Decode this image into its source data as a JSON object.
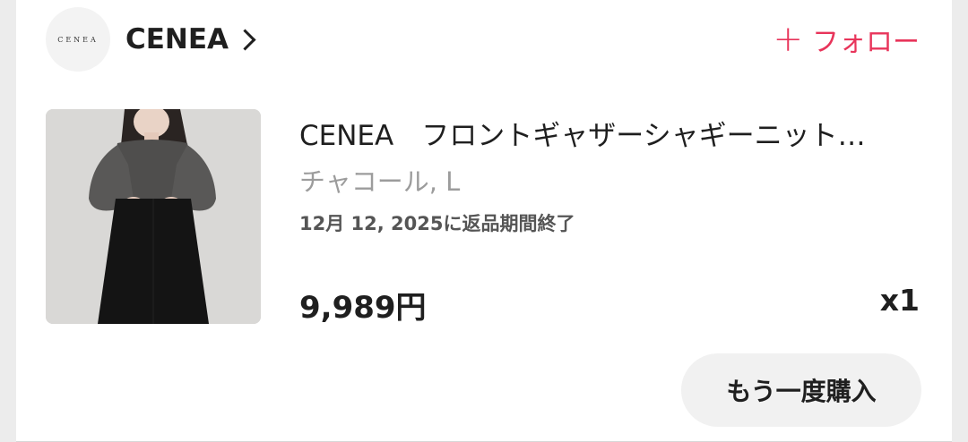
{
  "shop": {
    "logo_text": "CENEA",
    "name": "CENEA"
  },
  "follow": {
    "plus": "+",
    "label": "フォロー",
    "color": "#e8345a"
  },
  "product": {
    "image_icon": "product-photo",
    "title": "CENEA　フロントギャザーシャギーニット…",
    "variant": "チャコール, L",
    "return_deadline": "12月 12, 2025に返品期間終了",
    "price": "9,989円",
    "quantity": "x1"
  },
  "actions": {
    "buy_again": "もう一度購入"
  }
}
